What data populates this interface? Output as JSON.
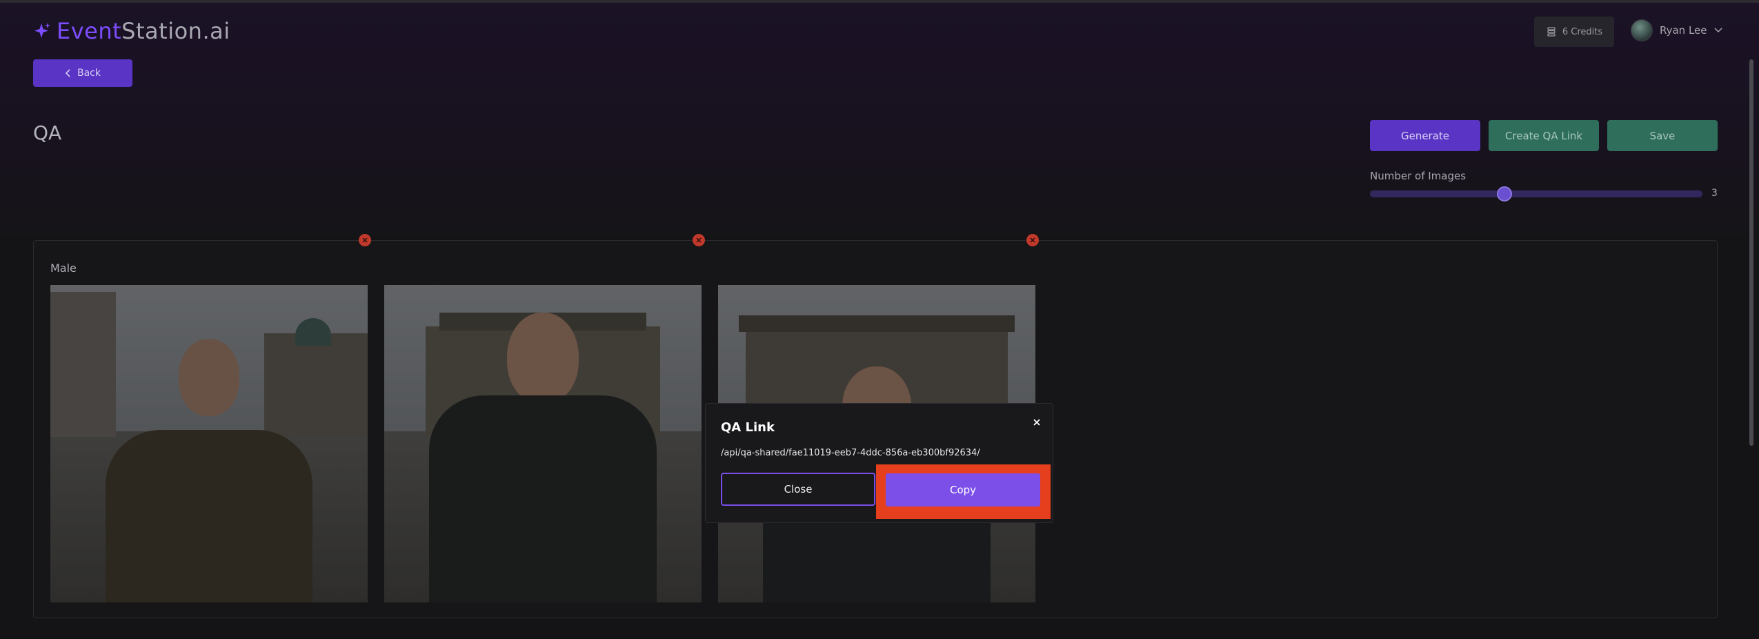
{
  "brand": {
    "name_accent": "Event",
    "name_rest": "Station.ai",
    "accent_color": "#7c4dff"
  },
  "nav": {
    "back_label": "Back"
  },
  "header": {
    "credits_label": "6 Credits",
    "user_name": "Ryan Lee"
  },
  "page": {
    "title": "QA"
  },
  "actions": {
    "generate_label": "Generate",
    "create_qa_link_label": "Create QA Link",
    "save_label": "Save"
  },
  "slider": {
    "label": "Number of Images",
    "value": "3",
    "fraction": 0.405
  },
  "section": {
    "title": "Male",
    "images": [
      {
        "icon": "portrait-photo"
      },
      {
        "icon": "portrait-photo"
      },
      {
        "icon": "portrait-photo"
      }
    ]
  },
  "modal": {
    "title": "QA Link",
    "link": "/api/qa-shared/fae11019-eeb7-4ddc-856a-eb300bf92634/",
    "close_label": "Close",
    "copy_label": "Copy",
    "highlight_color": "#e63f1d"
  }
}
